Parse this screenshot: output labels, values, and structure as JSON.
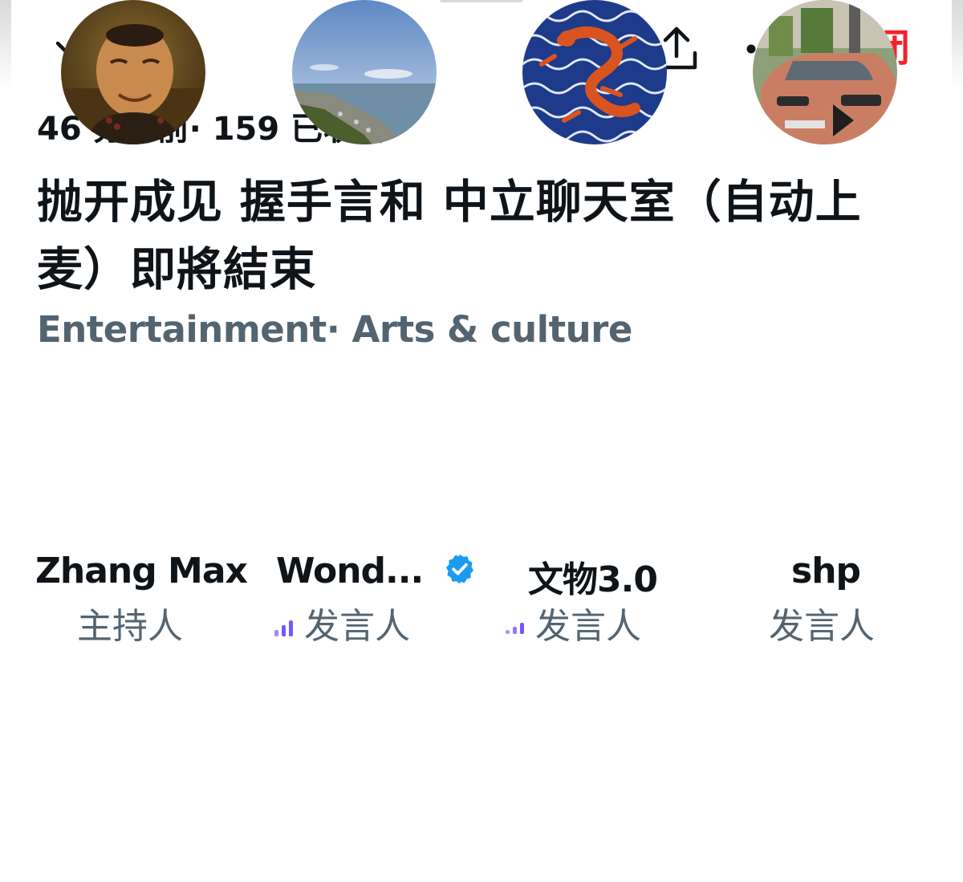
{
  "header": {
    "collapse_icon": "chevron-down-icon",
    "share_icon": "share-icon",
    "more_icon": "more-horizontal-icon",
    "close_label": "关闭"
  },
  "space": {
    "meta": "46 分钟前· 159 已收听",
    "title": "抛开成见 握手言和 中立聊天室（自动上麦）即將結束",
    "topics": "Entertainment· Arts & culture"
  },
  "participants": [
    {
      "name": "Zhang Max",
      "role": "主持人",
      "speaking": false,
      "verified": false
    },
    {
      "name": "Wond...",
      "role": "发言人",
      "speaking": true,
      "verified": true
    },
    {
      "name": "文物3.0",
      "role": "发言人",
      "speaking": true,
      "verified": false
    },
    {
      "name": "shp",
      "role": "发言人",
      "speaking": false,
      "verified": false
    }
  ],
  "colors": {
    "close": "#f4212e",
    "secondary_text": "#536471",
    "verified": "#1d9bf0",
    "speaking_indicator": "#7856ff"
  }
}
